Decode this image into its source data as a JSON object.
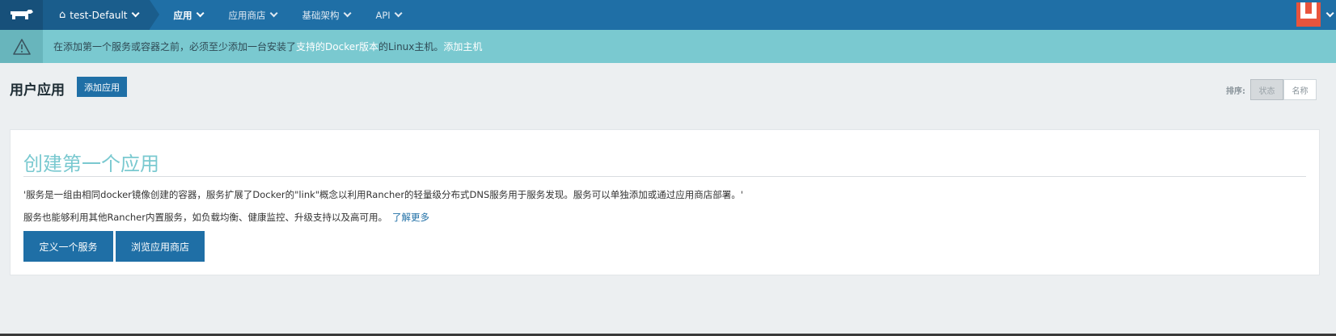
{
  "topnav": {
    "environment": "test-Default",
    "items": [
      {
        "label": "应用",
        "active": true
      },
      {
        "label": "应用商店",
        "active": false
      },
      {
        "label": "基础架构",
        "active": false
      },
      {
        "label": "API",
        "active": false
      }
    ],
    "colors": {
      "bar": "#1f6fa6",
      "logo_bg": "#17507a"
    }
  },
  "banner": {
    "text_prefix": "在添加第一个服务或容器之前，必须至少添加一台安装了",
    "link_docker": "支持的Docker版本",
    "text_middle": "的Linux主机。",
    "link_add_host": "添加主机",
    "icon": "warning-icon",
    "color": "#7ac9d0"
  },
  "header": {
    "title": "用户应用",
    "add_button": "添加应用",
    "sort_label": "排序:",
    "sort_options": [
      "状态",
      "名称"
    ]
  },
  "card": {
    "title": "创建第一个应用",
    "paragraph1": "'服务是一组由相同docker镜像创建的容器，服务扩展了Docker的\"link\"概念以利用Rancher的轻量级分布式DNS服务用于服务发现。服务可以单独添加或通过应用商店部署。'",
    "paragraph2": "服务也能够利用其他Rancher内置服务，如负载均衡、健康监控、升级支持以及高可用。",
    "learn_more": "了解更多",
    "buttons": [
      "定义一个服务",
      "浏览应用商店"
    ]
  }
}
